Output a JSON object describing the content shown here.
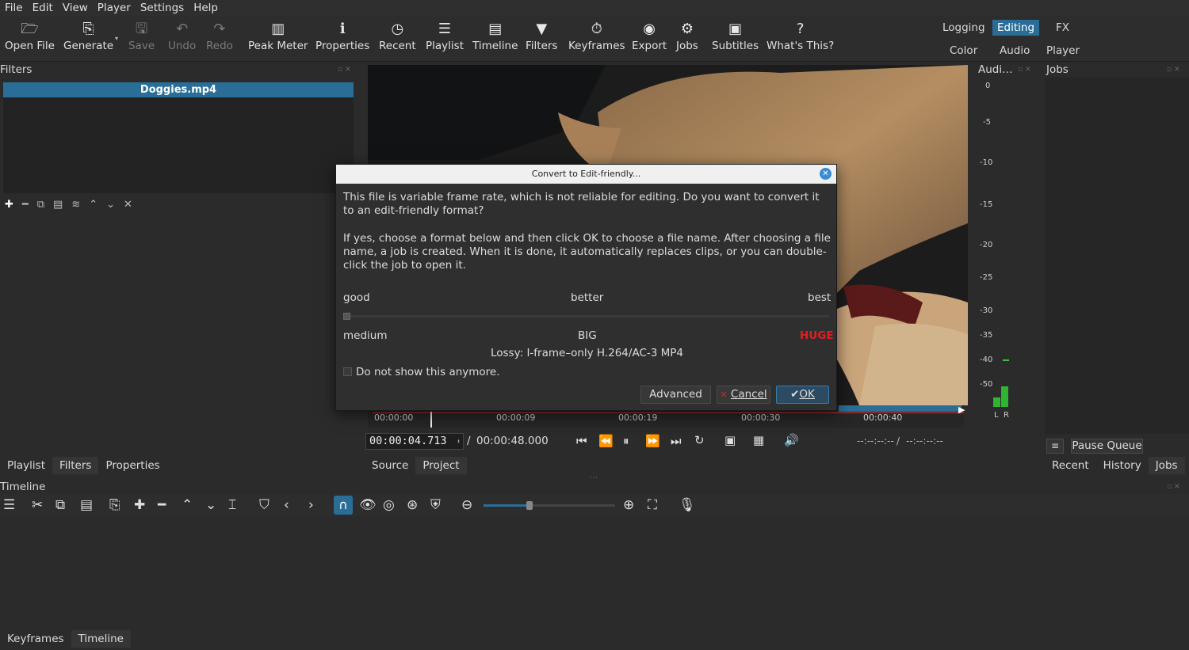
{
  "menu": [
    "File",
    "Edit",
    "View",
    "Player",
    "Settings",
    "Help"
  ],
  "toolbar": {
    "open_file": "Open File",
    "generate": "Generate",
    "save": "Save",
    "undo": "Undo",
    "redo": "Redo",
    "peak_meter": "Peak Meter",
    "properties": "Properties",
    "recent": "Recent",
    "playlist": "Playlist",
    "timeline": "Timeline",
    "filters": "Filters",
    "keyframes": "Keyframes",
    "export": "Export",
    "jobs": "Jobs",
    "subtitles": "Subtitles",
    "whats_this": "What's This?"
  },
  "layouts": {
    "logging": "Logging",
    "editing": "Editing",
    "fx": "FX",
    "color": "Color",
    "audio": "Audio",
    "player": "Player"
  },
  "filters_panel": {
    "title": "Filters",
    "clip_name": "Doggies.mp4"
  },
  "left_tabs": [
    "Playlist",
    "Filters",
    "Properties"
  ],
  "audio_panel": {
    "title": "Audi…",
    "scale": [
      "0",
      "-5",
      "-10",
      "-15",
      "-20",
      "-25",
      "-30",
      "-35",
      "-40",
      "-50"
    ],
    "left": "L",
    "right": "R",
    "level": "Green"
  },
  "jobs_panel": {
    "title": "Jobs",
    "pause_queue": "Pause Queue",
    "tabs": [
      "Recent",
      "History",
      "Jobs"
    ]
  },
  "dialog": {
    "title": "Convert to Edit-friendly...",
    "para1": "This file is variable frame rate, which is not reliable for editing. Do you want to convert it to an edit-friendly format?",
    "para2": "If yes, choose a format below and then click OK to choose a file name. After choosing a file name, a job is created. When it is done, it automatically replaces clips, or you can double-click the job to open it.",
    "quality_good": "good",
    "quality_better": "better",
    "quality_best": "best",
    "size_medium": "medium",
    "size_big": "BIG",
    "size_huge": "HUGE",
    "format": "Lossy: I-frame–only H.264/AC-3 MP4",
    "checkbox": "Do not show this anymore.",
    "advanced": "Advanced",
    "cancel": "Cancel",
    "ok": "OK",
    "slider_value": 0
  },
  "player": {
    "ruler": [
      "00:00:00",
      "00:00:09",
      "00:00:19",
      "00:00:30",
      "00:00:40"
    ],
    "position": "00:00:04.713",
    "separator": "/",
    "duration": "00:00:48.000",
    "in_point": "--:--:--:--",
    "out_point": "--:--:--:--",
    "tabs": [
      "Source",
      "Project"
    ]
  },
  "timeline": {
    "title": "Timeline"
  },
  "bottom_tabs": [
    "Keyframes",
    "Timeline"
  ],
  "colors": {
    "accent": "#2a6e97",
    "huge": "#e02020",
    "playhead": "#d9302a"
  }
}
